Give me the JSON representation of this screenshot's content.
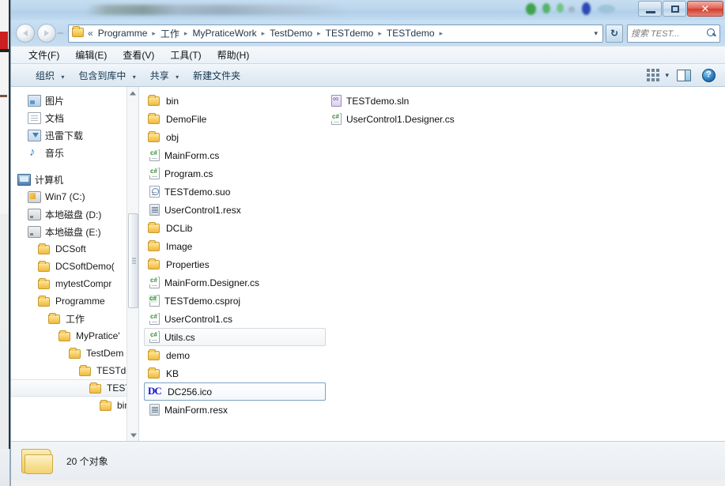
{
  "window": {
    "title": "",
    "controls": {
      "minimize": "–",
      "maximize": "□",
      "close": "✕"
    }
  },
  "address_bar": {
    "back_label": "◀",
    "forward_label": "▶",
    "overflow_chevron": "«",
    "folder_icon": "folder-icon",
    "separator": "▸",
    "dropdown": "▾",
    "refresh_label": "↻",
    "crumbs": [
      "Programme",
      "工作",
      "MyPraticeWork",
      "TestDemo",
      "TESTdemo",
      "TESTdemo"
    ]
  },
  "search": {
    "placeholder": "搜索 TEST...",
    "icon": "magnifier-icon"
  },
  "menubar": {
    "items": [
      "文件(F)",
      "编辑(E)",
      "查看(V)",
      "工具(T)",
      "帮助(H)"
    ]
  },
  "toolbar": {
    "buttons": [
      {
        "label": "组织",
        "caret": "▾"
      },
      {
        "label": "包含到库中",
        "caret": "▾"
      },
      {
        "label": "共享",
        "caret": "▾"
      },
      {
        "label": "新建文件夹",
        "caret": ""
      }
    ],
    "view_caret": "▾",
    "view_icon": "view-mode-icon",
    "preview_icon": "preview-pane-icon",
    "help_icon": "help-icon"
  },
  "sidebar": {
    "items": [
      {
        "label": "图片",
        "icon": "pictures-icon",
        "indent": 1,
        "selected": false
      },
      {
        "label": "文档",
        "icon": "documents-icon",
        "indent": 1,
        "selected": false
      },
      {
        "label": "迅雷下载",
        "icon": "downloads-icon",
        "indent": 1,
        "selected": false
      },
      {
        "label": "音乐",
        "icon": "music-icon",
        "indent": 1,
        "selected": false
      },
      {
        "label": "",
        "icon": "spacer",
        "indent": 0,
        "selected": false
      },
      {
        "label": "计算机",
        "icon": "computer-icon",
        "indent": 0,
        "selected": false
      },
      {
        "label": "Win7 (C:)",
        "icon": "hdd-windows-icon",
        "indent": 1,
        "selected": false
      },
      {
        "label": "本地磁盘 (D:)",
        "icon": "hdd-icon",
        "indent": 1,
        "selected": false
      },
      {
        "label": "本地磁盘 (E:)",
        "icon": "hdd-icon",
        "indent": 1,
        "selected": false
      },
      {
        "label": "DCSoft",
        "icon": "folder-icon",
        "indent": 2,
        "selected": false
      },
      {
        "label": "DCSoftDemo(",
        "icon": "folder-icon",
        "indent": 2,
        "selected": false
      },
      {
        "label": "mytestCompr",
        "icon": "folder-icon",
        "indent": 2,
        "selected": false
      },
      {
        "label": "Programme",
        "icon": "folder-icon",
        "indent": 2,
        "selected": false
      },
      {
        "label": "工作",
        "icon": "folder-icon",
        "indent": 3,
        "selected": false
      },
      {
        "label": "MyPratice'",
        "icon": "folder-icon",
        "indent": 4,
        "selected": false
      },
      {
        "label": "TestDem",
        "icon": "folder-icon",
        "indent": 5,
        "selected": false
      },
      {
        "label": "TESTdе",
        "icon": "folder-icon",
        "indent": 6,
        "selected": false
      },
      {
        "label": "TEST",
        "icon": "folder-icon",
        "indent": 7,
        "selected": true
      },
      {
        "label": "bin",
        "icon": "folder-icon",
        "indent": 8,
        "selected": false
      }
    ],
    "scrollbar": {
      "up_arrow": "▲",
      "down_arrow": "▼"
    }
  },
  "files": [
    {
      "name": "bin",
      "type": "folder",
      "state": "normal"
    },
    {
      "name": "DemoFile",
      "type": "folder",
      "state": "normal"
    },
    {
      "name": "obj",
      "type": "folder",
      "state": "normal"
    },
    {
      "name": "MainForm.cs",
      "type": "cs",
      "state": "normal"
    },
    {
      "name": "Program.cs",
      "type": "cs",
      "state": "normal"
    },
    {
      "name": "TESTdemo.suo",
      "type": "suo",
      "state": "normal"
    },
    {
      "name": "UserControl1.resx",
      "type": "resx",
      "state": "normal"
    },
    {
      "name": "DCLib",
      "type": "folder",
      "state": "normal"
    },
    {
      "name": "Image",
      "type": "folder",
      "state": "normal"
    },
    {
      "name": "Properties",
      "type": "folder",
      "state": "normal"
    },
    {
      "name": "MainForm.Designer.cs",
      "type": "cs",
      "state": "normal"
    },
    {
      "name": "TESTdemo.csproj",
      "type": "csproj",
      "state": "normal"
    },
    {
      "name": "UserControl1.cs",
      "type": "cs",
      "state": "normal"
    },
    {
      "name": "Utils.cs",
      "type": "cs",
      "state": "hovered"
    },
    {
      "name": "demo",
      "type": "folder",
      "state": "normal"
    },
    {
      "name": "KB",
      "type": "folder",
      "state": "normal"
    },
    {
      "name": "DC256.ico",
      "type": "ico",
      "state": "selected"
    },
    {
      "name": "MainForm.resx",
      "type": "resx",
      "state": "normal"
    },
    {
      "name": "TESTdemo.sln",
      "type": "sln",
      "state": "normal"
    },
    {
      "name": "UserControl1.Designer.cs",
      "type": "cs",
      "state": "normal"
    }
  ],
  "statusbar": {
    "count_text": "20 个对象",
    "folder_icon": "large-folder-icon"
  },
  "colors": {
    "accent": "#2f7cc4",
    "selection_border": "#7da2c4",
    "close_button": "#cf3f31",
    "folder_yellow": "#f9d36c"
  }
}
